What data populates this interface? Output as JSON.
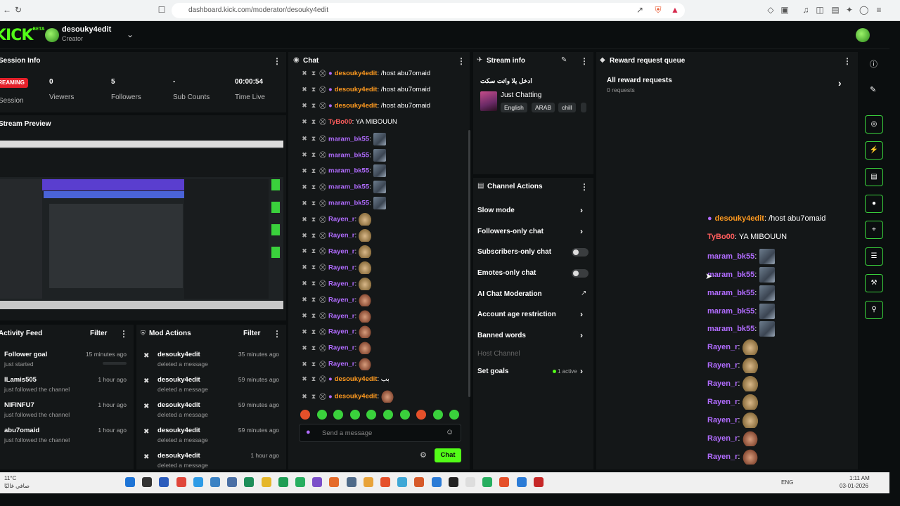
{
  "browser": {
    "url": "dashboard.kick.com/moderator/desouky4edit"
  },
  "header": {
    "logo": "KICK",
    "logo_badge": "BETA",
    "username": "desouky4edit",
    "role": "Creator"
  },
  "session_info": {
    "title": "Session Info",
    "status_badge": "STREAMING",
    "session_label": "Session",
    "stats": [
      {
        "value": "0",
        "label": "Viewers"
      },
      {
        "value": "5",
        "label": "Followers"
      },
      {
        "value": "-",
        "label": "Sub Counts"
      },
      {
        "value": "00:00:54",
        "label": "Time Live"
      }
    ]
  },
  "stream_preview": {
    "title": "Stream Preview"
  },
  "activity_feed": {
    "title": "Activity Feed",
    "filter_label": "Filter",
    "items": [
      {
        "name": "Follower goal",
        "sub": "just started",
        "time": "15 minutes ago",
        "progress": 0
      },
      {
        "name": "ILamis505",
        "sub": "just followed the channel",
        "time": "1 hour ago"
      },
      {
        "name": "NIFINFU7",
        "sub": "just followed the channel",
        "time": "1 hour ago"
      },
      {
        "name": "abu7omaid",
        "sub": "just followed the channel",
        "time": "1 hour ago"
      }
    ]
  },
  "mod_actions": {
    "title": "Mod Actions",
    "filter_label": "Filter",
    "items": [
      {
        "name": "desouky4edit",
        "sub": "deleted a message",
        "time": "35 minutes ago"
      },
      {
        "name": "desouky4edit",
        "sub": "deleted a message",
        "time": "59 minutes ago"
      },
      {
        "name": "desouky4edit",
        "sub": "deleted a message",
        "time": "59 minutes ago"
      },
      {
        "name": "desouky4edit",
        "sub": "deleted a message",
        "time": "59 minutes ago"
      },
      {
        "name": "desouky4edit",
        "sub": "deleted a message",
        "time": "1 hour ago"
      }
    ]
  },
  "chat": {
    "title": "Chat",
    "input_placeholder": "Send a message",
    "send_label": "Chat",
    "messages": [
      {
        "user": "desouky4edit",
        "color": "orange",
        "text": ": /host abu7omaid",
        "emote": ""
      },
      {
        "user": "desouky4edit",
        "color": "orange",
        "text": ": /host abu7omaid",
        "emote": ""
      },
      {
        "user": "desouky4edit",
        "color": "orange",
        "text": ": /host abu7omaid",
        "emote": ""
      },
      {
        "user": "TyBo00",
        "color": "red",
        "text": ": YA MIBOUUN",
        "emote": ""
      },
      {
        "user": "maram_bk55",
        "color": "purple",
        "text": ":",
        "emote": "girl"
      },
      {
        "user": "maram_bk55",
        "color": "purple",
        "text": ":",
        "emote": "girl"
      },
      {
        "user": "maram_bk55",
        "color": "purple",
        "text": ":",
        "emote": "girl"
      },
      {
        "user": "maram_bk55",
        "color": "purple",
        "text": ":",
        "emote": "girl"
      },
      {
        "user": "maram_bk55",
        "color": "purple",
        "text": ":",
        "emote": "girl"
      },
      {
        "user": "Rayen_r",
        "color": "purple",
        "text": ":",
        "emote": "cat"
      },
      {
        "user": "Rayen_r",
        "color": "purple",
        "text": ":",
        "emote": "cat"
      },
      {
        "user": "Rayen_r",
        "color": "purple",
        "text": ":",
        "emote": "cat"
      },
      {
        "user": "Rayen_r",
        "color": "purple",
        "text": ":",
        "emote": "cat"
      },
      {
        "user": "Rayen_r",
        "color": "purple",
        "text": ":",
        "emote": "cat"
      },
      {
        "user": "Rayen_r",
        "color": "purple",
        "text": ":",
        "emote": "hand"
      },
      {
        "user": "Rayen_r",
        "color": "purple",
        "text": ":",
        "emote": "hand"
      },
      {
        "user": "Rayen_r",
        "color": "purple",
        "text": ":",
        "emote": "hand"
      },
      {
        "user": "Rayen_r",
        "color": "purple",
        "text": ":",
        "emote": "hand"
      },
      {
        "user": "Rayen_r",
        "color": "purple",
        "text": ":",
        "emote": "hand"
      },
      {
        "user": "desouky4edit",
        "color": "orange",
        "text": ": بب",
        "emote": ""
      },
      {
        "user": "desouky4edit",
        "color": "orange",
        "text": ":",
        "emote": "hand"
      }
    ]
  },
  "stream_info": {
    "title": "Stream info",
    "stream_title": "ادخل يلا واتت سكت",
    "category": "Just Chatting",
    "tags": [
      "English",
      "ARAB",
      "chill"
    ]
  },
  "channel_actions": {
    "title": "Channel Actions",
    "slow_mode": "Slow mode",
    "followers_only": "Followers-only chat",
    "subscribers_only": "Subscribers-only chat",
    "emotes_only": "Emotes-only chat",
    "ai_moderation": "AI Chat Moderation",
    "account_age": "Account age restriction",
    "banned_words": "Banned words",
    "host_channel": "Host Channel",
    "set_goals": "Set goals",
    "goals_status": "1 active"
  },
  "reward_queue": {
    "title": "Reward request queue",
    "item_title": "All reward requests",
    "item_sub": "0 requests",
    "overlay_messages": [
      {
        "user": "desouky4edit",
        "color": "orange",
        "text": ": /host abu7omaid",
        "emote": ""
      },
      {
        "user": "TyBo00",
        "color": "red",
        "text": ": YA MIBOUUN",
        "emote": ""
      },
      {
        "user": "maram_bk55",
        "color": "purple",
        "text": ":",
        "emote": "girl"
      },
      {
        "user": "maram_bk55",
        "color": "purple",
        "text": ":",
        "emote": "girl"
      },
      {
        "user": "maram_bk55",
        "color": "purple",
        "text": ":",
        "emote": "girl"
      },
      {
        "user": "maram_bk55",
        "color": "purple",
        "text": ":",
        "emote": "girl"
      },
      {
        "user": "maram_bk55",
        "color": "purple",
        "text": ":",
        "emote": "girl"
      },
      {
        "user": "Rayen_r",
        "color": "purple",
        "text": ":",
        "emote": "cat"
      },
      {
        "user": "Rayen_r",
        "color": "purple",
        "text": ":",
        "emote": "cat"
      },
      {
        "user": "Rayen_r",
        "color": "purple",
        "text": ":",
        "emote": "cat"
      },
      {
        "user": "Rayen_r",
        "color": "purple",
        "text": ":",
        "emote": "cat"
      },
      {
        "user": "Rayen_r",
        "color": "purple",
        "text": ":",
        "emote": "cat"
      },
      {
        "user": "Rayen_r",
        "color": "purple",
        "text": ":",
        "emote": "hand"
      },
      {
        "user": "Rayen_r",
        "color": "purple",
        "text": ":",
        "emote": "hand"
      }
    ]
  },
  "taskbar": {
    "weather_temp": "11°C",
    "weather_desc": "صافي غالبًا",
    "lang": "ENG",
    "time": "1:11 AM",
    "date": "03-01-2026"
  },
  "colors": {
    "accent": "#53fc18",
    "streaming_badge": "#e5202a",
    "user_orange": "#ff9a1f",
    "user_purple": "#b16cff",
    "user_red": "#ff5d5d"
  }
}
